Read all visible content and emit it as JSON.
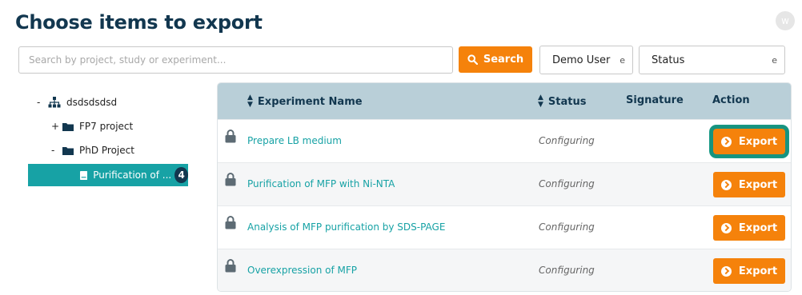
{
  "header": {
    "title": "Choose items to export",
    "avatar_initial": "w"
  },
  "search": {
    "placeholder": "Search by project, study or experiment...",
    "value": "",
    "button_label": "Search"
  },
  "filters": {
    "user": {
      "value": "Demo User",
      "chevron": "e"
    },
    "status": {
      "value": "Status",
      "chevron": "e"
    }
  },
  "tree": {
    "items": [
      {
        "toggle": "-",
        "label": "dsdsdsdsd",
        "icon": "hierarchy-icon"
      },
      {
        "toggle": "+",
        "label": "FP7 project",
        "icon": "folder-icon"
      },
      {
        "toggle": "-",
        "label": "PhD Project",
        "icon": "folder-icon"
      },
      {
        "toggle": "",
        "label": "Purification of ...",
        "icon": "notebook-icon",
        "badge": "4",
        "selected": true
      }
    ]
  },
  "table": {
    "columns": {
      "name": "Experiment Name",
      "status": "Status",
      "signature": "Signature",
      "action": "Action"
    },
    "rows": [
      {
        "name": "Prepare LB medium",
        "status": "Configuring",
        "signature": "",
        "action": "Export",
        "focused": true
      },
      {
        "name": "Purification of MFP with Ni-NTA",
        "status": "Configuring",
        "signature": "",
        "action": "Export"
      },
      {
        "name": "Analysis of MFP purification by SDS-PAGE",
        "status": "Configuring",
        "signature": "",
        "action": "Export"
      },
      {
        "name": "Overexpression of MFP",
        "status": "Configuring",
        "signature": "",
        "action": "Export"
      }
    ]
  },
  "colors": {
    "accent_orange": "#f5820b",
    "teal": "#17a2a5",
    "navy": "#12374f",
    "header_bg": "#b9cfd8"
  }
}
